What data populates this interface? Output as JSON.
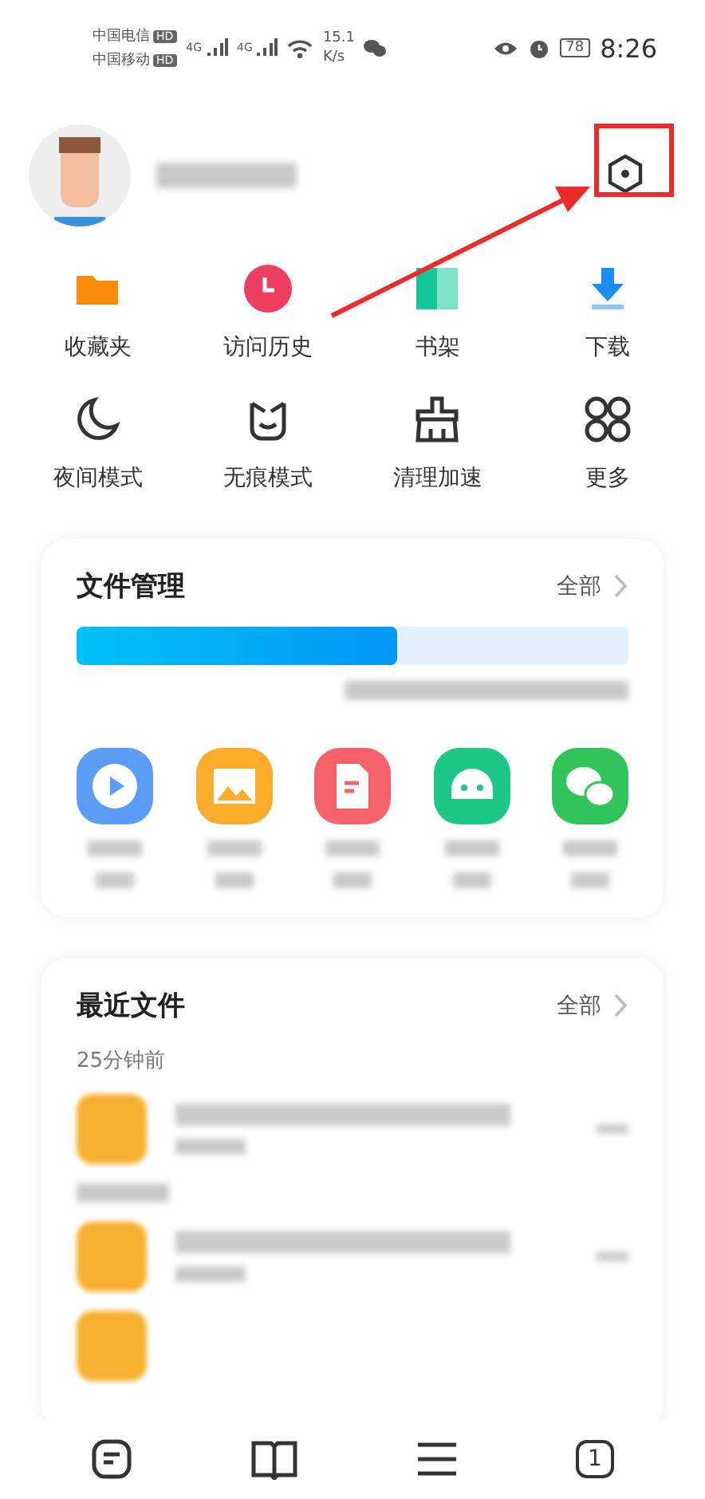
{
  "status_bar": {
    "carriers": [
      {
        "name": "中国电信",
        "badge": "HD"
      },
      {
        "name": "中国移动",
        "badge": "HD"
      }
    ],
    "signals": [
      "4G",
      "4G"
    ],
    "speed": "15.1",
    "speed_unit": "K/s",
    "battery": "78",
    "time": "8:26"
  },
  "quick_actions": [
    {
      "label": "收藏夹",
      "kind": "folder"
    },
    {
      "label": "访问历史",
      "kind": "clock"
    },
    {
      "label": "书架",
      "kind": "book"
    },
    {
      "label": "下载",
      "kind": "download"
    },
    {
      "label": "夜间模式",
      "kind": "moon"
    },
    {
      "label": "无痕模式",
      "kind": "face"
    },
    {
      "label": "清理加速",
      "kind": "broom"
    },
    {
      "label": "更多",
      "kind": "grid"
    }
  ],
  "file_manager": {
    "title": "文件管理",
    "link": "全部",
    "storage": {
      "level": 0.58
    },
    "categories": [
      {
        "kind": "video"
      },
      {
        "kind": "image"
      },
      {
        "kind": "doc"
      },
      {
        "kind": "android"
      },
      {
        "kind": "wechat"
      }
    ]
  },
  "recent_files": {
    "title": "最近文件",
    "link": "全部",
    "group": "25分钟前",
    "files": [
      {
        "kind": "file"
      },
      {
        "kind": "label"
      },
      {
        "kind": "file"
      },
      {
        "kind": "partial"
      }
    ]
  },
  "bottom_nav": [
    {
      "kind": "home"
    },
    {
      "kind": "book"
    },
    {
      "kind": "menu"
    },
    {
      "kind": "tabs",
      "count": "1"
    }
  ]
}
